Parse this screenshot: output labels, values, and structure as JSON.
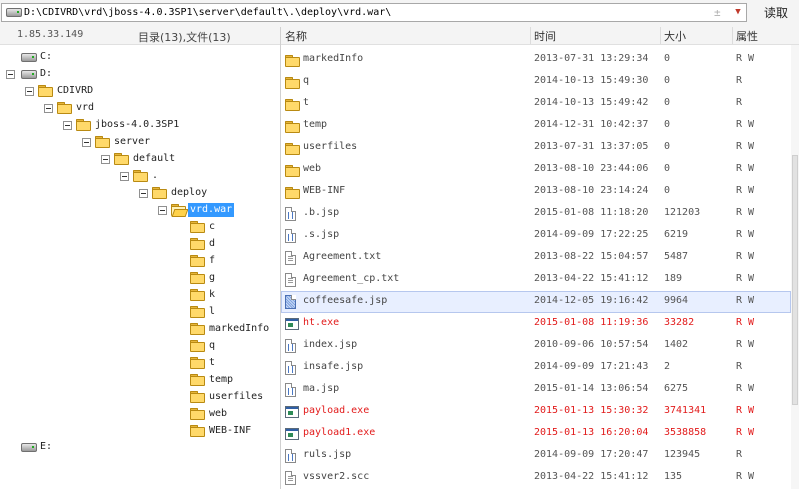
{
  "address_bar": {
    "path": "D:\\CDIVRD\\vrd\\jboss-4.0.3SP1\\server\\default\\.\\deploy\\vrd.war\\",
    "plusminus_glyph": "±",
    "dropdown_glyph": "▼",
    "read_label": "读取"
  },
  "left_panel": {
    "ip": "1.85.33.149",
    "summary": "目录(13),文件(13)"
  },
  "tree": [
    {
      "label": "C:",
      "type": "drive"
    },
    {
      "label": "D:",
      "type": "drive"
    },
    {
      "label": "CDIVRD",
      "type": "folder"
    },
    {
      "label": "vrd",
      "type": "folder"
    },
    {
      "label": "jboss-4.0.3SP1",
      "type": "folder"
    },
    {
      "label": "server",
      "type": "folder"
    },
    {
      "label": "default",
      "type": "folder"
    },
    {
      "label": ".",
      "type": "folder"
    },
    {
      "label": "deploy",
      "type": "folder"
    },
    {
      "label": "vrd.war",
      "type": "folder"
    },
    {
      "label": "c",
      "type": "folder"
    },
    {
      "label": "d",
      "type": "folder"
    },
    {
      "label": "f",
      "type": "folder"
    },
    {
      "label": "g",
      "type": "folder"
    },
    {
      "label": "k",
      "type": "folder"
    },
    {
      "label": "l",
      "type": "folder"
    },
    {
      "label": "markedInfo",
      "type": "folder"
    },
    {
      "label": "q",
      "type": "folder"
    },
    {
      "label": "t",
      "type": "folder"
    },
    {
      "label": "temp",
      "type": "folder"
    },
    {
      "label": "userfiles",
      "type": "folder"
    },
    {
      "label": "web",
      "type": "folder"
    },
    {
      "label": "WEB-INF",
      "type": "folder"
    },
    {
      "label": "E:",
      "type": "drive"
    }
  ],
  "list": {
    "headers": {
      "name": "名称",
      "time": "时间",
      "size": "大小",
      "attr": "属性"
    },
    "rows": [
      {
        "name": "markedInfo",
        "time": "2013-07-31 13:29:34",
        "size": "0",
        "attr": "R W",
        "icon": "folder-icon"
      },
      {
        "name": "q",
        "time": "2014-10-13 15:49:30",
        "size": "0",
        "attr": "R",
        "icon": "folder-icon"
      },
      {
        "name": "t",
        "time": "2014-10-13 15:49:42",
        "size": "0",
        "attr": "R",
        "icon": "folder-icon"
      },
      {
        "name": "temp",
        "time": "2014-12-31 10:42:37",
        "size": "0",
        "attr": "R W",
        "icon": "folder-icon"
      },
      {
        "name": "userfiles",
        "time": "2013-07-31 13:37:05",
        "size": "0",
        "attr": "R W",
        "icon": "folder-icon"
      },
      {
        "name": "web",
        "time": "2013-08-10 23:44:06",
        "size": "0",
        "attr": "R W",
        "icon": "folder-icon"
      },
      {
        "name": "WEB-INF",
        "time": "2013-08-10 23:14:24",
        "size": "0",
        "attr": "R W",
        "icon": "folder-icon"
      },
      {
        "name": ".b.jsp",
        "time": "2015-01-08 11:18:20",
        "size": "121203",
        "attr": "R W",
        "icon": "jsp-file-icon"
      },
      {
        "name": ".s.jsp",
        "time": "2014-09-09 17:22:25",
        "size": "6219",
        "attr": "R W",
        "icon": "jsp-file-icon"
      },
      {
        "name": "Agreement.txt",
        "time": "2013-08-22 15:04:57",
        "size": "5487",
        "attr": "R W",
        "icon": "text-file-icon"
      },
      {
        "name": "Agreement_cp.txt",
        "time": "2013-04-22 15:41:12",
        "size": "189",
        "attr": "R W",
        "icon": "text-file-icon"
      },
      {
        "name": "coffeesafe.jsp",
        "time": "2014-12-05 19:16:42",
        "size": "9964",
        "attr": "R W",
        "icon": "selected-file-icon"
      },
      {
        "name": "ht.exe",
        "time": "2015-01-08 11:19:36",
        "size": "33282",
        "attr": "R W",
        "icon": "exe-file-icon"
      },
      {
        "name": "index.jsp",
        "time": "2010-09-06 10:57:54",
        "size": "1402",
        "attr": "R W",
        "icon": "jsp-file-icon"
      },
      {
        "name": "insafe.jsp",
        "time": "2014-09-09 17:21:43",
        "size": "2",
        "attr": "R",
        "icon": "jsp-file-icon"
      },
      {
        "name": "ma.jsp",
        "time": "2015-01-14 13:06:54",
        "size": "6275",
        "attr": "R W",
        "icon": "jsp-file-icon"
      },
      {
        "name": "payload.exe",
        "time": "2015-01-13 15:30:32",
        "size": "3741341",
        "attr": "R W",
        "icon": "exe-file-icon"
      },
      {
        "name": "payload1.exe",
        "time": "2015-01-13 16:20:04",
        "size": "3538858",
        "attr": "R W",
        "icon": "exe-file-icon"
      },
      {
        "name": "ruls.jsp",
        "time": "2014-09-09 17:20:47",
        "size": "123945",
        "attr": "R",
        "icon": "jsp-file-icon"
      },
      {
        "name": "vssver2.scc",
        "time": "2013-04-22 15:41:12",
        "size": "135",
        "attr": "R W",
        "icon": "text-file-icon"
      }
    ]
  },
  "colors": {
    "selection": "#3399ff",
    "exe_text": "#e21b1b",
    "folder": "#ffd96a"
  }
}
